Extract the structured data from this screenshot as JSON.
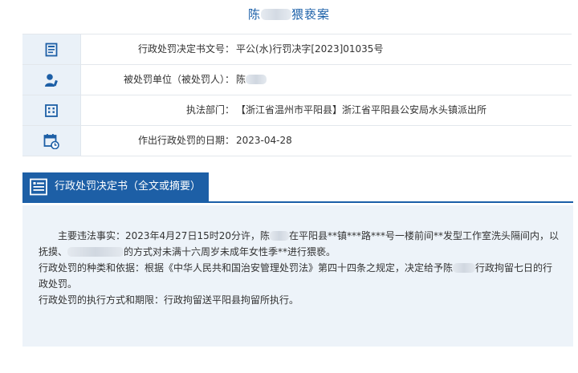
{
  "page": {
    "title_prefix": "陈",
    "title_suffix": "猥亵案"
  },
  "info_rows": [
    {
      "icon": "document-icon",
      "label": "行政处罚决定书文号：",
      "value": "平公(水)行罚决字[2023]01035号"
    },
    {
      "icon": "person-icon",
      "label": "被处罚单位（被处罚人）：",
      "value": "陈"
    },
    {
      "icon": "building-icon",
      "label": "执法部门：",
      "value": "【浙江省温州市平阳县】浙江省平阳县公安局水头镇派出所"
    },
    {
      "icon": "calendar-icon",
      "label": "作出行政处罚的日期：",
      "value": "2023-04-28"
    }
  ],
  "section": {
    "icon": "list-document-icon",
    "title": "行政处罚决定书（全文或摘要）"
  },
  "content": {
    "p1_a": "主要违法事实：2023年4月27日15时20分许，陈",
    "p1_b": "在平阳县**镇***路***号一楼前间**发型工作室洗头隔间内，以抚摸、",
    "p1_c": "的方式对未满十六周岁未成年女性季**进行猥亵。",
    "p2_a": "行政处罚的种类和依据：根据《中华人民共和国治安管理处罚法》第四十四条之规定，决定给予陈",
    "p2_b": "行政拘留七日的行政处罚。",
    "p3": "行政处罚的执行方式和期限：行政拘留送平阳县拘留所执行。"
  },
  "colors": {
    "accent": "#1a5fa8",
    "icon_cell_bg": "#eaf1f8",
    "content_bg": "#edf3f9"
  }
}
